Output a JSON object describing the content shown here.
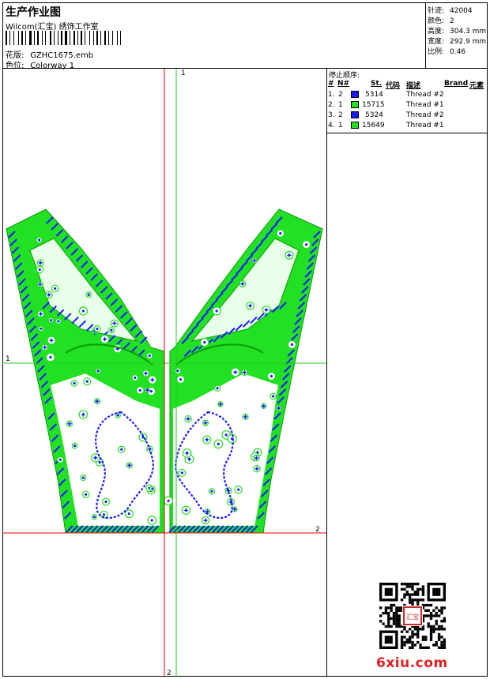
{
  "header": {
    "title": "生产作业图",
    "subtitle": "Wilcom(汇宝) 绣饰工作室",
    "design_label": "花版:",
    "design_value": "GZHC1675.emb",
    "colorway_label": "色位:",
    "colorway_value": "Colorway 1"
  },
  "info": {
    "stitches_label": "针迹:",
    "stitches_value": "42004",
    "colors_label": "颜色:",
    "colors_value": "2",
    "height_label": "高度:",
    "height_value": "304.3 mm",
    "width_label": "宽度:",
    "width_value": "292.9 mm",
    "scale_label": "比例:",
    "scale_value": "0.46"
  },
  "stop_sequence": {
    "title": "停止顺序:",
    "headers": {
      "index": "#",
      "num": "N#",
      "st": "St.",
      "code": "代码",
      "desc": "描述",
      "brand": "Brand",
      "element": "元素"
    },
    "rows": [
      {
        "index": "1.",
        "n": "2",
        "color": "#1a1aff",
        "code": "5314",
        "desc": "Thread #2"
      },
      {
        "index": "2.",
        "n": "1",
        "color": "#22e022",
        "code": "15715",
        "desc": "Thread #1"
      },
      {
        "index": "3.",
        "n": "2",
        "color": "#1a1aff",
        "code": "5324",
        "desc": "Thread #2"
      },
      {
        "index": "4.",
        "n": "1",
        "color": "#22e022",
        "code": "15649",
        "desc": "Thread #1"
      }
    ]
  },
  "axes": {
    "v_green_label": "1",
    "h_green_label": "1",
    "h_red_label": "2",
    "v_red_label": "2",
    "green": "#22cc22",
    "red": "#dd0000"
  },
  "thread_colors": {
    "green": "#22e022",
    "blue": "#1a1aff"
  },
  "watermark": "6xiu.com",
  "stamp_text": "汇宝"
}
